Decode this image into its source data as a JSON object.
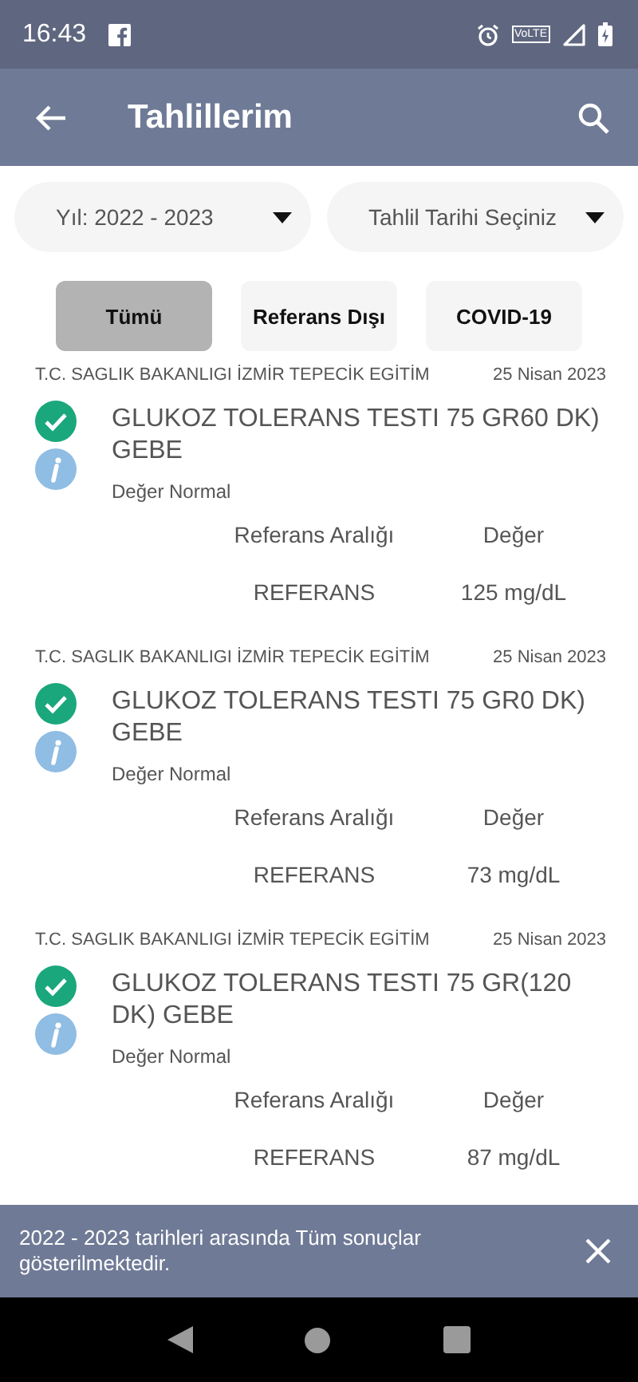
{
  "status_bar": {
    "time": "16:43",
    "network_label": "VoLTE"
  },
  "app_bar": {
    "title": "Tahlillerim"
  },
  "dropdowns": [
    {
      "value": "Yıl: 2022 - 2023"
    },
    {
      "value": "Tahlil Tarihi Seçiniz"
    }
  ],
  "filters": [
    {
      "label": "Tümü",
      "selected": true
    },
    {
      "label": "Referans Dışı",
      "selected": false
    },
    {
      "label": "COVID-19",
      "selected": false
    }
  ],
  "results": [
    {
      "source": "T.C. SAGLIK BAKANLIGI İZMİR TEPECİK EGİTİM",
      "date": "25 Nisan 2023",
      "test": "GLUKOZ TOLERANS TESTI 75 GR60 DK) GEBE",
      "in_range": true,
      "status": "Değer Normal",
      "column_1": "Referans Aralığı",
      "column_2": "Değer",
      "reference": "REFERANS",
      "value": "125 mg/dL"
    },
    {
      "source": "T.C. SAGLIK BAKANLIGI İZMİR TEPECİK EGİTİM",
      "date": "25 Nisan 2023",
      "test": "GLUKOZ TOLERANS TESTI 75 GR0 DK) GEBE",
      "in_range": true,
      "status": "Değer Normal",
      "column_1": "Referans Aralığı",
      "column_2": "Değer",
      "reference": "REFERANS",
      "value": "73 mg/dL"
    },
    {
      "source": "T.C. SAGLIK BAKANLIGI İZMİR TEPECİK EGİTİM",
      "date": "25 Nisan 2023",
      "test": "GLUKOZ TOLERANS TESTI 75 GR(120 DK) GEBE",
      "in_range": true,
      "status": "Değer Normal",
      "column_1": "Referans Aralığı",
      "column_2": "Değer",
      "reference": "REFERANS",
      "value": "87 mg/dL"
    }
  ],
  "snackbar": {
    "message": "2022 - 2023 tarihleri arasında Tüm sonuçlar gösterilmektedir."
  }
}
